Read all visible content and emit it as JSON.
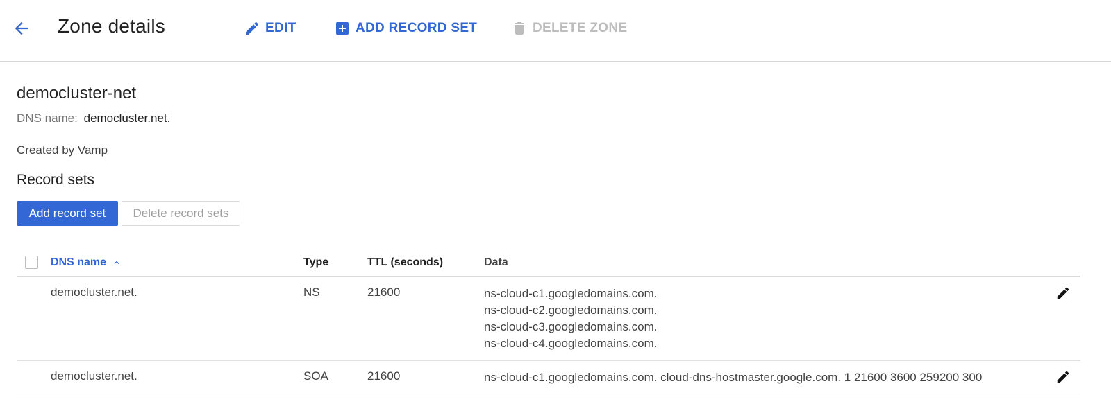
{
  "header": {
    "title": "Zone details",
    "edit_label": "EDIT",
    "add_record_set_label": "ADD RECORD SET",
    "delete_zone_label": "DELETE ZONE"
  },
  "zone": {
    "name": "democluster-net",
    "dns_label": "DNS name:",
    "dns_value": "democluster.net.",
    "created_by": "Created by Vamp"
  },
  "records": {
    "title": "Record sets",
    "add_button": "Add record set",
    "delete_button": "Delete record sets",
    "columns": {
      "dns_name": "DNS name",
      "type": "Type",
      "ttl": "TTL (seconds)",
      "data": "Data"
    },
    "rows": [
      {
        "dns_name": "democluster.net.",
        "type": "NS",
        "ttl": "21600",
        "data": [
          "ns-cloud-c1.googledomains.com.",
          "ns-cloud-c2.googledomains.com.",
          "ns-cloud-c3.googledomains.com.",
          "ns-cloud-c4.googledomains.com."
        ]
      },
      {
        "dns_name": "democluster.net.",
        "type": "SOA",
        "ttl": "21600",
        "data": [
          "ns-cloud-c1.googledomains.com. cloud-dns-hostmaster.google.com. 1 21600 3600 259200 300"
        ]
      }
    ]
  },
  "icons": {
    "back": "arrow-back-icon",
    "edit": "pencil-icon",
    "add": "add-box-icon",
    "delete": "trash-icon",
    "sort": "chevron-up-icon"
  },
  "colors": {
    "accent": "#3367d6",
    "disabled": "#bdbdbd",
    "divider": "#d6d6d6"
  }
}
